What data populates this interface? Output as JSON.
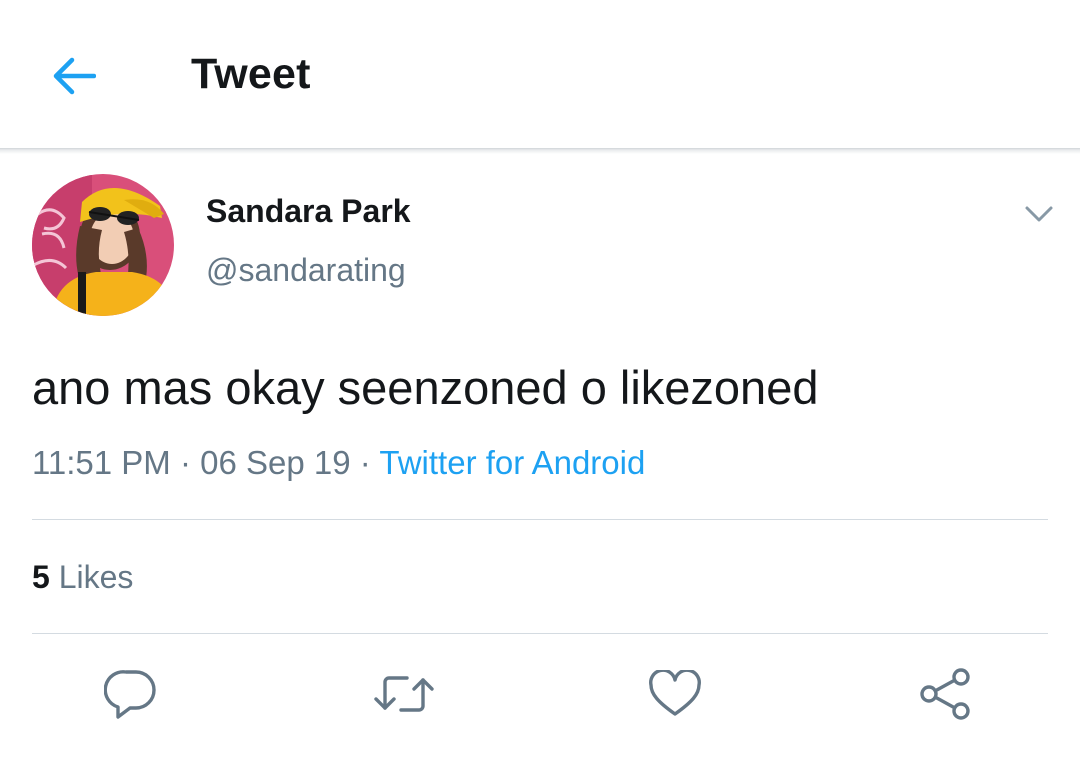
{
  "header": {
    "title": "Tweet",
    "back_icon": "arrow-left-icon",
    "accent_color": "#1da1f2"
  },
  "author": {
    "name": "Sandara Park",
    "handle": "@sandarating",
    "caret_icon": "chevron-down-icon"
  },
  "tweet": {
    "text": "ano mas okay seenzoned o likezoned",
    "time": "11:51 PM",
    "separator": "·",
    "date": "06 Sep 19",
    "source": "Twitter for Android"
  },
  "stats": {
    "likes_count": "5",
    "likes_label": "Likes"
  },
  "actions": [
    {
      "icon": "reply-icon"
    },
    {
      "icon": "retweet-icon"
    },
    {
      "icon": "heart-icon"
    },
    {
      "icon": "share-icon"
    }
  ],
  "colors": {
    "text_primary": "#14171a",
    "text_secondary": "#657786",
    "link": "#1da1f2",
    "divider": "#d4dbe1"
  }
}
